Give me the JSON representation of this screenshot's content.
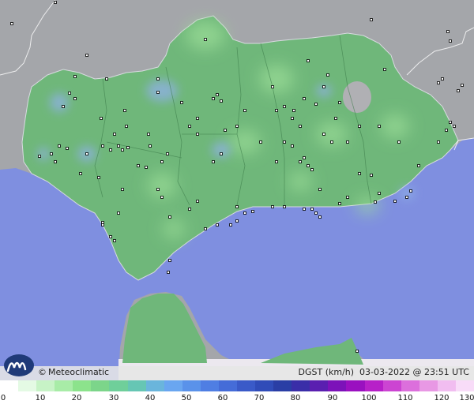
{
  "brand": {
    "copyright": "©",
    "name": "Meteoclimatic"
  },
  "variable": "DGST",
  "units": "(km/h)",
  "date": "03-03-2022",
  "at": "@",
  "time": "23:51 UTC",
  "colors": {
    "sea": "#7f8fe0",
    "land_outside": "#a4a6aa",
    "region_base": "#6fb77a",
    "calm": "#9fe09a",
    "breezy": "#8fb0e6",
    "station_fill": "#ffffff",
    "station_stroke": "#000000"
  },
  "scale": {
    "ticks": [
      "0",
      "10",
      "20",
      "30",
      "40",
      "50",
      "60",
      "70",
      "80",
      "90",
      "100",
      "110",
      "120",
      "130"
    ],
    "colors": [
      "#ffffff",
      "#e4fae4",
      "#c7f3c6",
      "#a8eca7",
      "#8ce38c",
      "#7cd58a",
      "#6fcf9a",
      "#66c6b4",
      "#6ab5dc",
      "#6aa6f0",
      "#5a92ea",
      "#4f7ee3",
      "#456cd8",
      "#3a5ac8",
      "#304cb8",
      "#2a3ea5",
      "#3a2ea8",
      "#5a1fb0",
      "#7c12b9",
      "#9a10c0",
      "#b720c8",
      "#cc44d2",
      "#dc6fdc",
      "#e898e4",
      "#f1bdf0",
      "#f8dcf8"
    ]
  }
}
